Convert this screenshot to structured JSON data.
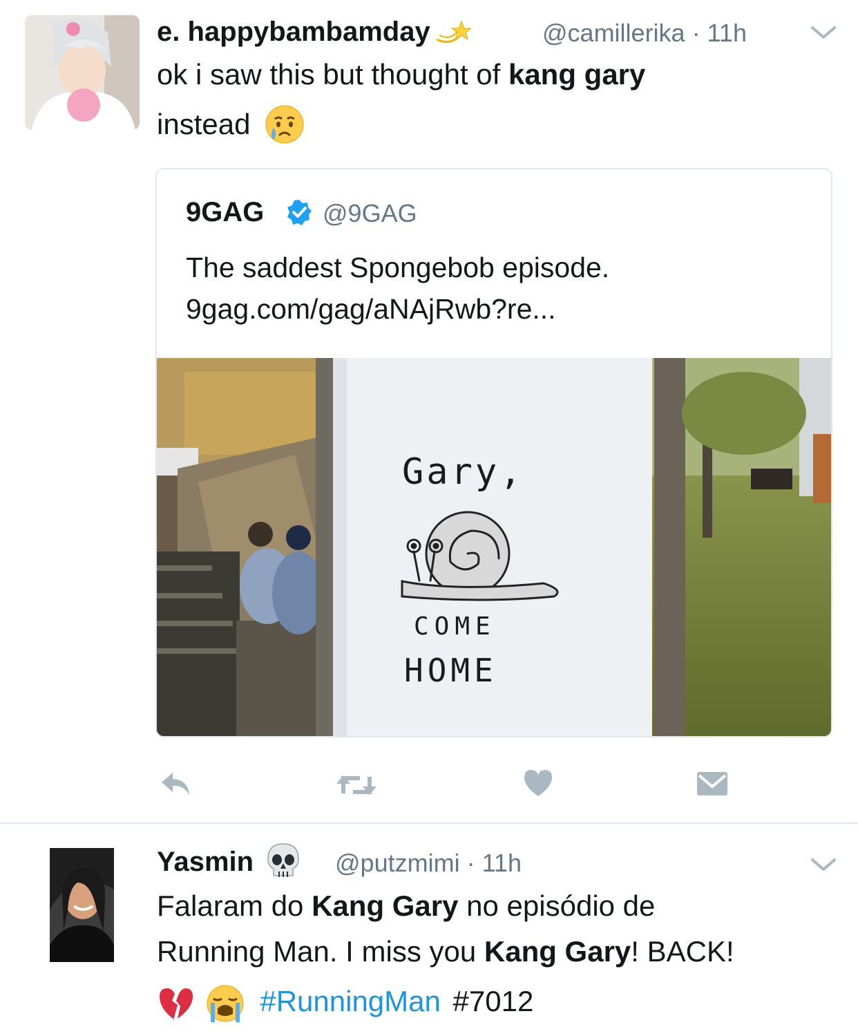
{
  "tweet1": {
    "name": "e. happybambamday",
    "handle": "@camillerika",
    "time": "· 11h",
    "text_a": "ok i saw this but thought of ",
    "text_bold": "kang gary",
    "text_b": "instead",
    "quote": {
      "name": "9GAG",
      "handle": "@9GAG",
      "line1": "The saddest Spongebob episode.",
      "line2": "9gag.com/gag/aNAjRwb?re...",
      "sign_line1": "Gary,",
      "sign_line2": "COME",
      "sign_line3": "HOME"
    },
    "actions": [
      "reply-icon",
      "retweet-icon",
      "like-icon",
      "message-icon"
    ]
  },
  "tweet2": {
    "name": "Yasmin",
    "handle": "@putzmimi",
    "time": "· 11h",
    "t1": "Falaram do ",
    "b1": "Kang Gary",
    "t2": " no episódio de",
    "t3": "Running Man. I miss you ",
    "b2": "Kang Gary",
    "t4": "! BACK!",
    "hashtag": "#RunningMan",
    "tag": "#7012"
  },
  "colors": {
    "link": "#1b95e0",
    "muted": "#657786",
    "verified": "#1da1f2",
    "icon": "#aab8c2"
  }
}
